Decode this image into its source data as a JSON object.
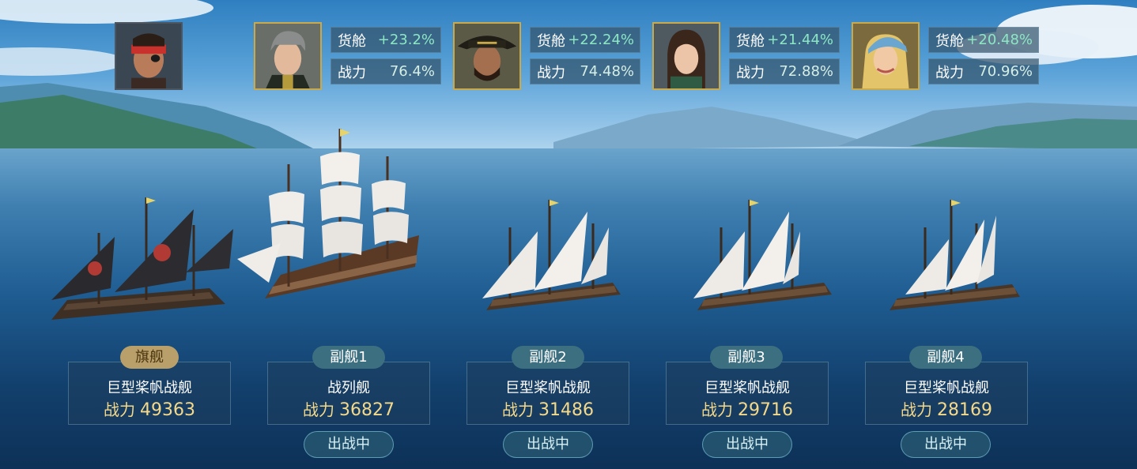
{
  "commander": {
    "icon": "pirate-captain-portrait"
  },
  "officers": [
    {
      "icon": "gray-haired-officer-portrait",
      "cargo_label": "货舱",
      "cargo_value": "+23.2%",
      "power_label": "战力",
      "power_value": "76.4%"
    },
    {
      "icon": "bearded-captain-portrait",
      "cargo_label": "货舱",
      "cargo_value": "+22.24%",
      "power_label": "战力",
      "power_value": "74.48%"
    },
    {
      "icon": "dark-haired-woman-portrait",
      "cargo_label": "货舱",
      "cargo_value": "+21.44%",
      "power_label": "战力",
      "power_value": "72.88%"
    },
    {
      "icon": "blonde-bandana-woman-portrait",
      "cargo_label": "货舱",
      "cargo_value": "+20.48%",
      "power_label": "战力",
      "power_value": "70.96%"
    }
  ],
  "ships": [
    {
      "badge": "旗舰",
      "class": "巨型桨帆战舰",
      "power_label": "战力",
      "power": "49363",
      "icon": "black-pirate-galley"
    },
    {
      "badge": "副舰1",
      "class": "战列舰",
      "power_label": "战力",
      "power": "36827",
      "status": "出战中",
      "icon": "ship-of-the-line"
    },
    {
      "badge": "副舰2",
      "class": "巨型桨帆战舰",
      "power_label": "战力",
      "power": "31486",
      "status": "出战中",
      "icon": "white-sail-galley"
    },
    {
      "badge": "副舰3",
      "class": "巨型桨帆战舰",
      "power_label": "战力",
      "power": "29716",
      "status": "出战中",
      "icon": "white-sail-galley"
    },
    {
      "badge": "副舰4",
      "class": "巨型桨帆战舰",
      "power_label": "战力",
      "power": "28169",
      "status": "出战中",
      "icon": "white-sail-galley"
    }
  ],
  "colors": {
    "cargo_value": "#8ce6c4",
    "power_number": "#f4d98a",
    "flagship_badge": "#b9a06a",
    "sub_badge": "#3c6f80",
    "portrait_border": "#c9a94a"
  }
}
